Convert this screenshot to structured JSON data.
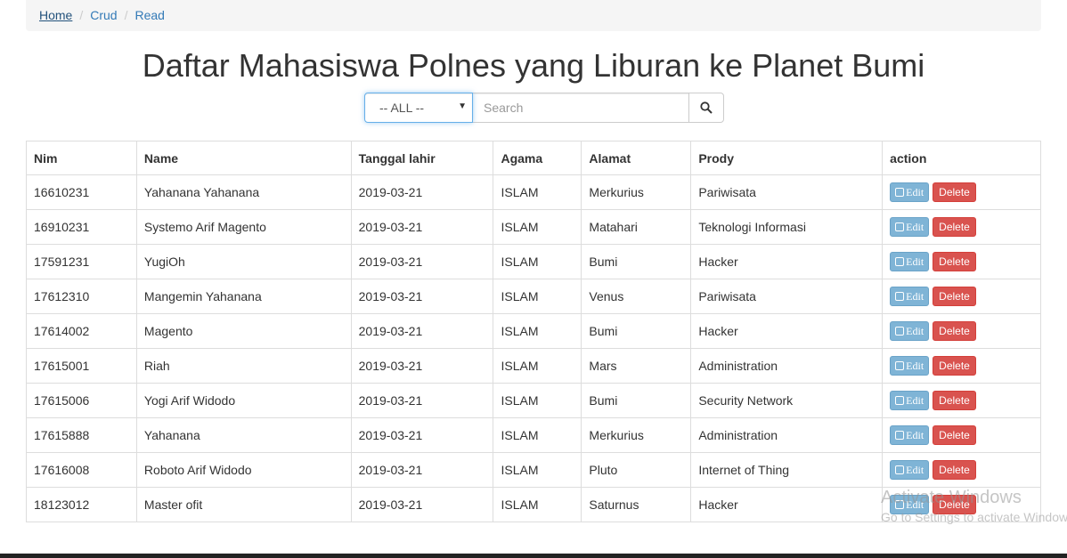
{
  "breadcrumb": {
    "home": "Home",
    "crud": "Crud",
    "read": "Read"
  },
  "page_title": "Daftar Mahasiswa Polnes yang Liburan ke Planet Bumi",
  "filter": {
    "selected": "-- ALL --",
    "search_placeholder": "Search"
  },
  "table": {
    "headers": [
      "Nim",
      "Name",
      "Tanggal lahir",
      "Agama",
      "Alamat",
      "Prody",
      "action"
    ],
    "edit_label": "Edit",
    "delete_label": "Delete",
    "rows": [
      [
        "16610231",
        "Yahanana Yahanana",
        "2019-03-21",
        "ISLAM",
        "Merkurius",
        "Pariwisata"
      ],
      [
        "16910231",
        "Systemo Arif Magento",
        "2019-03-21",
        "ISLAM",
        "Matahari",
        "Teknologi Informasi"
      ],
      [
        "17591231",
        "YugiOh",
        "2019-03-21",
        "ISLAM",
        "Bumi",
        "Hacker"
      ],
      [
        "17612310",
        "Mangemin Yahanana",
        "2019-03-21",
        "ISLAM",
        "Venus",
        "Pariwisata"
      ],
      [
        "17614002",
        "Magento",
        "2019-03-21",
        "ISLAM",
        "Bumi",
        "Hacker"
      ],
      [
        "17615001",
        "Riah",
        "2019-03-21",
        "ISLAM",
        "Mars",
        "Administration"
      ],
      [
        "17615006",
        "Yogi Arif Widodo",
        "2019-03-21",
        "ISLAM",
        "Bumi",
        "Security Network"
      ],
      [
        "17615888",
        "Yahanana",
        "2019-03-21",
        "ISLAM",
        "Merkurius",
        "Administration"
      ],
      [
        "17616008",
        "Roboto Arif Widodo",
        "2019-03-21",
        "ISLAM",
        "Pluto",
        "Internet of Thing"
      ],
      [
        "18123012",
        "Master ofit",
        "2019-03-21",
        "ISLAM",
        "Saturnus",
        "Hacker"
      ]
    ]
  },
  "watermark": {
    "line1": "Activate Windows",
    "line2": "Go to Settings to activate Windows."
  }
}
